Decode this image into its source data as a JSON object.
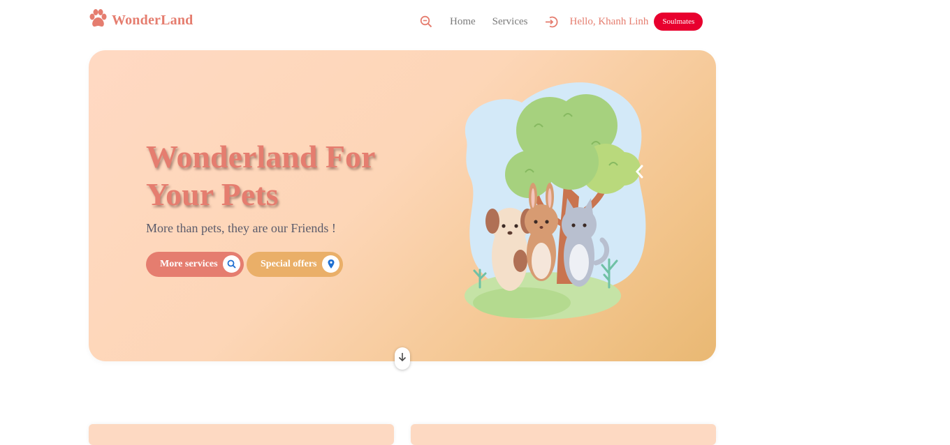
{
  "brand": {
    "name": "WonderLand",
    "logo_icon": "paw-icon",
    "color": "#e57d6f"
  },
  "nav": {
    "search_icon": "zoom-search-icon",
    "links": [
      "Home",
      "Services"
    ],
    "login_icon": "sign-in-icon",
    "greeting": "Hello, Khanh Linh",
    "badge": "Soulmates",
    "badge_color": "#e8002e"
  },
  "hero": {
    "title_line1": "Wonderland For",
    "title_line2": "Your Pets",
    "subtitle": "More than pets, they are our Friends !",
    "buttons": [
      {
        "label": "More services",
        "icon": "search-icon",
        "color": "#e57d6f"
      },
      {
        "label": "Special offers",
        "icon": "location-pin-icon",
        "color": "#eaaf68"
      }
    ],
    "illustration": "pets-under-tree-illustration",
    "arrow_icon": "chevron-left-icon",
    "scroll_icon": "arrow-down-icon"
  }
}
